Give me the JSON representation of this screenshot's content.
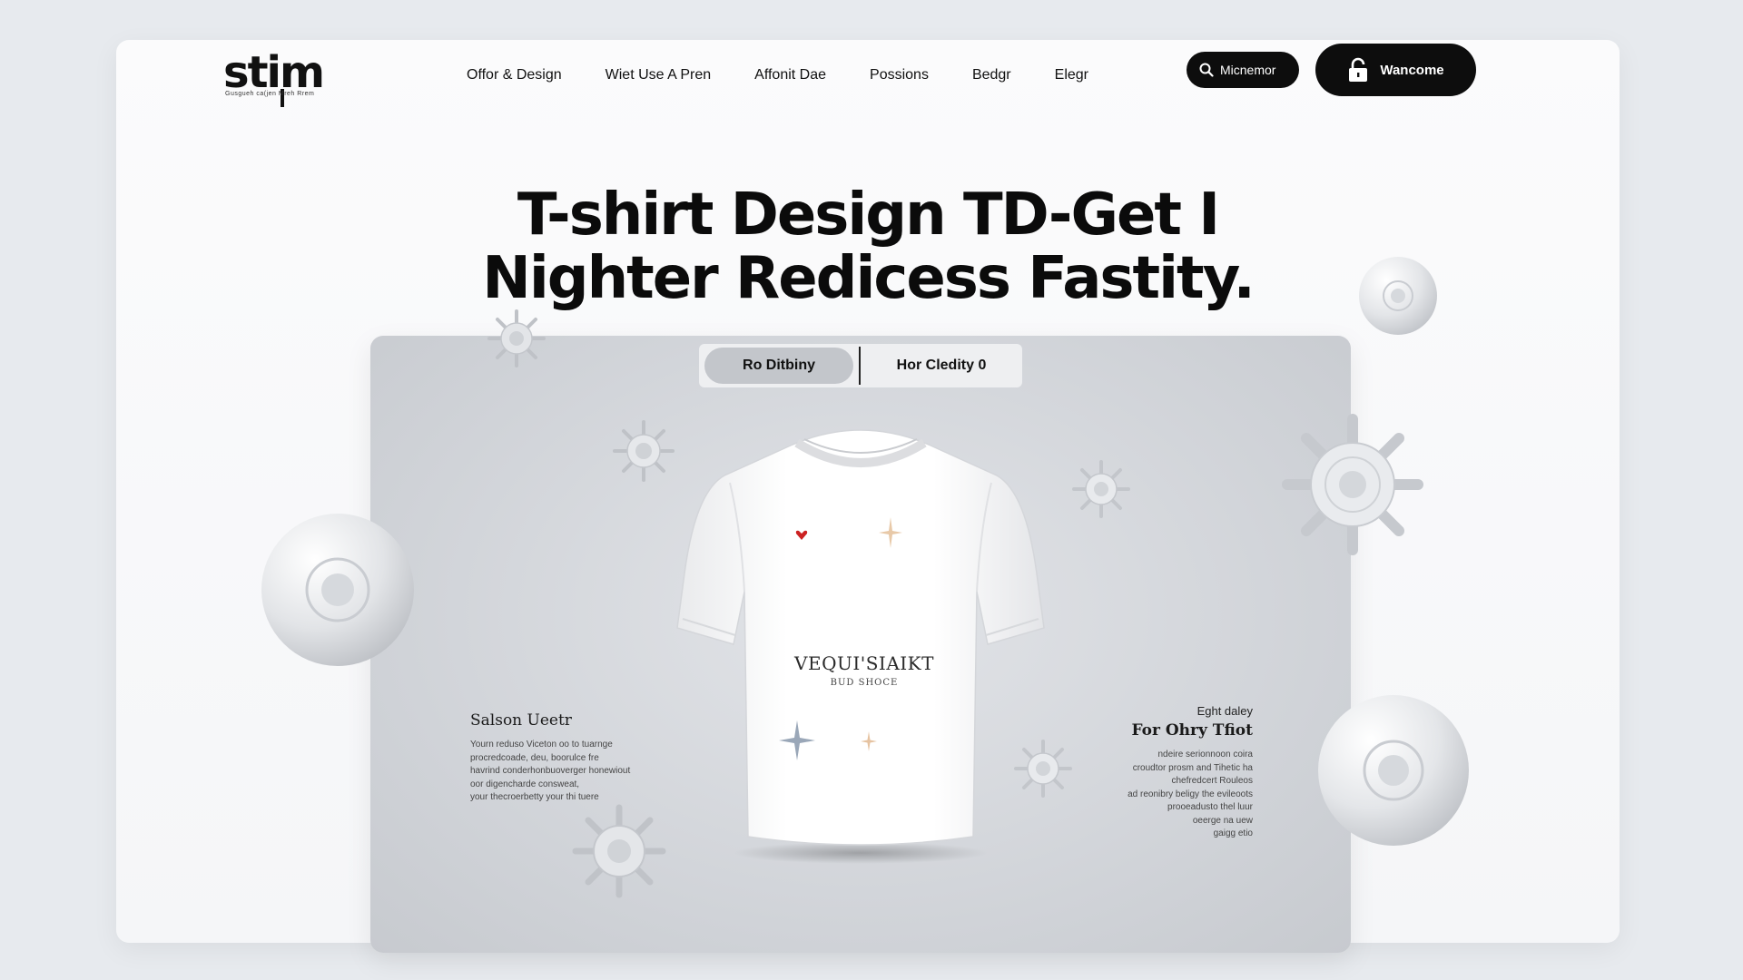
{
  "header": {
    "logo_text": "stim",
    "logo_tagline": "Gusgueh ca(jen Mreh Rrem",
    "nav": [
      "Offor & Design",
      "Wiet Use A Pren",
      "Affonit Dae",
      "Possions",
      "Bedgr",
      "Elegr"
    ],
    "search_label": "Micnemor",
    "welcome_label": "Wancome"
  },
  "hero": {
    "line1": "T-shirt Design TD-Get I",
    "line2": "Nighter Redicess Fastity."
  },
  "stage": {
    "toggle_active": "Ro Ditbiny",
    "toggle_other": "Hor Cledity 0",
    "shirt_print_title": "VEQUI'SIAIKT",
    "shirt_print_sub": "BUD SHOCE",
    "left": {
      "title": "Salson Ueetr",
      "lines": [
        "Yourn reduso Viceton oo to tuarnge",
        "procredcoade, deu, boorulce fre",
        "havrind conderhonbuoverger honewiout",
        "oor digencharde consweat,",
        "your thecroerbetty your thi tuere"
      ]
    },
    "right": {
      "kicker": "Eght daley",
      "title": "For Ohry Tfiot",
      "lines": [
        "ndeire serionnoon coira",
        "croudtor prosm and Tihetic ha",
        "chefredcert Rouleos",
        "ad reonibry beligy the evileoots",
        "prooeadusto thel luur",
        "oeerge na uew",
        "gaigg etio"
      ]
    }
  },
  "colors": {
    "background": "#e7eaee",
    "card": "#fbfbfc",
    "accent_dark": "#0d0d0d",
    "stage": "#cfd2d7",
    "shirt_heart": "#cc2222"
  },
  "icons": [
    "search-icon",
    "lock-icon",
    "heart-icon",
    "sparkle-icon",
    "virus-ornament-icon",
    "sphere-ornament-icon"
  ]
}
